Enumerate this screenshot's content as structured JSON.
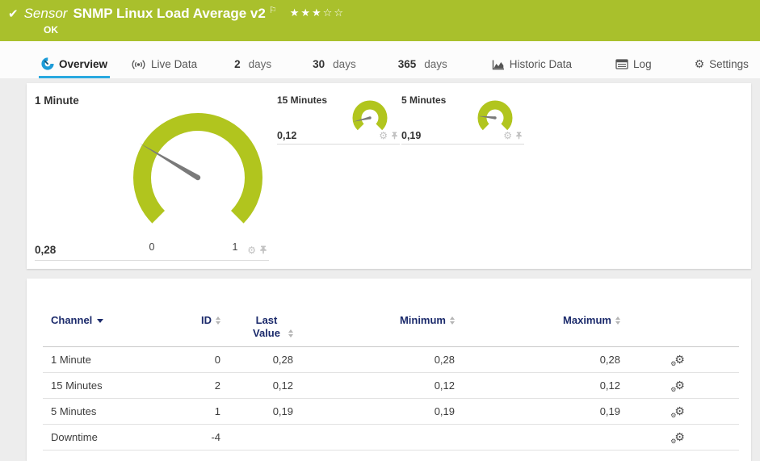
{
  "header": {
    "kind_label": "Sensor",
    "title": "SNMP Linux Load Average v2",
    "status": "OK",
    "status_icon": "check-icon",
    "flag_icon": "flag-icon",
    "stars_filled": 3,
    "stars_total": 5
  },
  "tabs": [
    {
      "label": "Overview",
      "icon": "gauge-icon",
      "active": true
    },
    {
      "label": "Live Data",
      "icon": "live-data-icon",
      "active": false
    },
    {
      "num": "2",
      "label": "days",
      "active": false
    },
    {
      "num": "30",
      "label": "days",
      "active": false
    },
    {
      "num": "365",
      "label": "days",
      "active": false
    },
    {
      "label": "Historic Data",
      "icon": "historic-data-icon",
      "active": false
    },
    {
      "label": "Log",
      "icon": "log-icon",
      "active": false
    },
    {
      "label": "Settings",
      "icon": "gear-icon",
      "active": false
    }
  ],
  "gauges": [
    {
      "name": "1 Minute",
      "value": 0.28,
      "value_label": "0,28",
      "min": 0,
      "max": 1,
      "scale_labels": [
        "0",
        "1"
      ],
      "size": "large",
      "icons": [
        "gear-icon",
        "pin-icon"
      ]
    },
    {
      "name": "15 Minutes",
      "value": 0.12,
      "value_label": "0,12",
      "min": 0,
      "max": 1,
      "size": "small",
      "icons": [
        "gear-icon",
        "pin-icon"
      ]
    },
    {
      "name": "5 Minutes",
      "value": 0.19,
      "value_label": "0,19",
      "min": 0,
      "max": 1,
      "size": "small",
      "icons": [
        "gear-icon",
        "pin-icon"
      ]
    }
  ],
  "table": {
    "columns": [
      {
        "label": "Channel",
        "sort": "desc"
      },
      {
        "label": "ID",
        "sort": "both"
      },
      {
        "label": "Last Value",
        "sort": "both"
      },
      {
        "label": "Minimum",
        "sort": "both"
      },
      {
        "label": "Maximum",
        "sort": "both"
      },
      {
        "label": "",
        "sort": "none"
      }
    ],
    "rows": [
      {
        "channel": "1 Minute",
        "id": "0",
        "last": "0,28",
        "min": "0,28",
        "max": "0,28",
        "edit_icon": "double-gear-icon"
      },
      {
        "channel": "15 Minutes",
        "id": "2",
        "last": "0,12",
        "min": "0,12",
        "max": "0,12",
        "edit_icon": "double-gear-icon"
      },
      {
        "channel": "5 Minutes",
        "id": "1",
        "last": "0,19",
        "min": "0,19",
        "max": "0,19",
        "edit_icon": "double-gear-icon"
      },
      {
        "channel": "Downtime",
        "id": "-4",
        "last": "",
        "min": "",
        "max": "",
        "edit_icon": "double-gear-icon"
      }
    ]
  },
  "colors": {
    "header_green": "#a9c02c",
    "gauge_green": "#b1c51e",
    "needle_gray": "#7a7a7a",
    "tab_active_blue": "#29a9e0",
    "table_header_navy": "#1b2a6b"
  }
}
